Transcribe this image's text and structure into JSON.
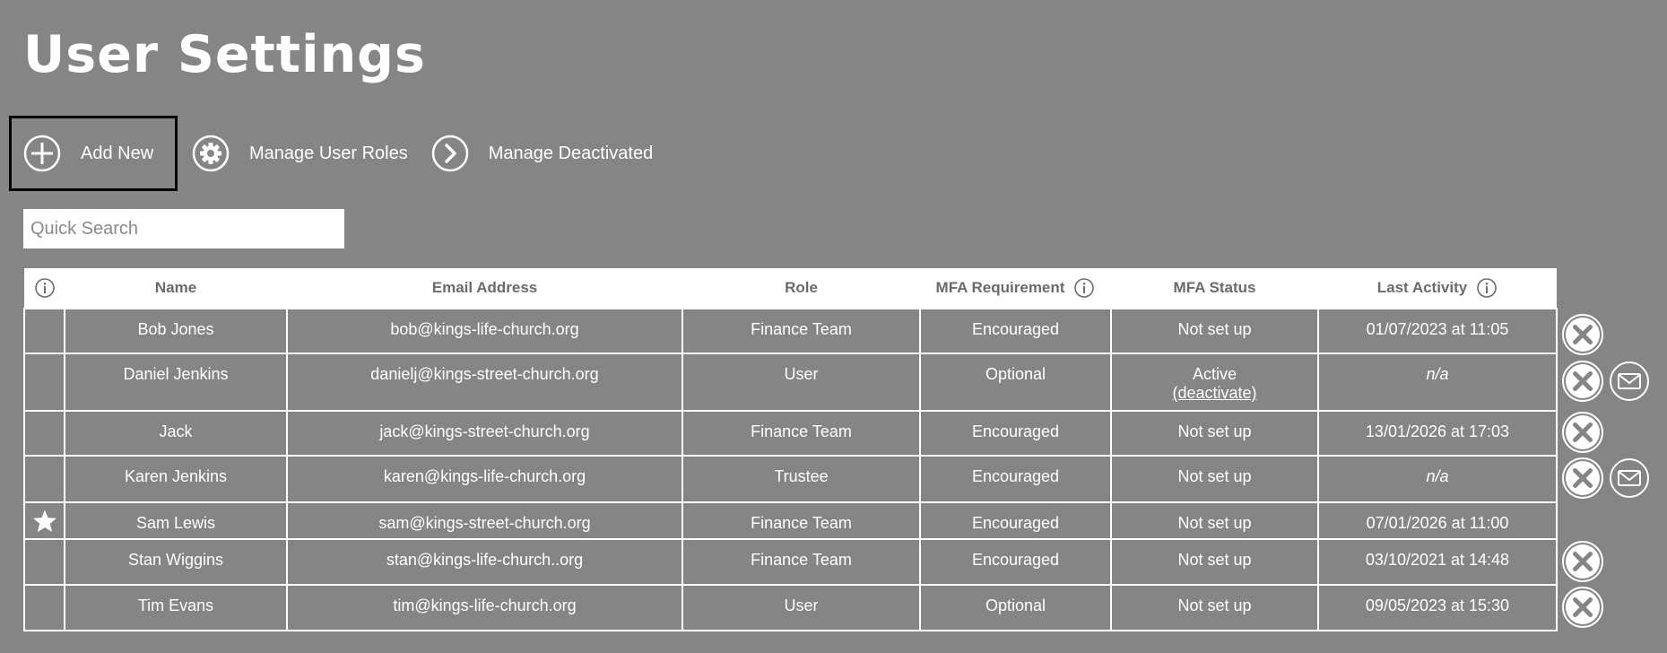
{
  "page": {
    "title": "User Settings"
  },
  "toolbar": {
    "add_new": "Add New",
    "manage_roles": "Manage User Roles",
    "manage_deactivated": "Manage Deactivated"
  },
  "search": {
    "placeholder": "Quick Search",
    "value": ""
  },
  "table": {
    "headers": {
      "name": "Name",
      "email": "Email Address",
      "role": "Role",
      "mfa_requirement": "MFA Requirement",
      "mfa_status": "MFA Status",
      "last_activity": "Last Activity"
    },
    "rows": [
      {
        "flag": "",
        "name": "Bob Jones",
        "email": "bob@kings-life-church.org",
        "role": "Finance Team",
        "mfa_requirement": "Encouraged",
        "mfa_status": "Not set up",
        "mfa_action": "",
        "last_activity": "01/07/2023 at 11:05",
        "actions": [
          "remove"
        ]
      },
      {
        "flag": "",
        "name": "Daniel Jenkins",
        "email": "danielj@kings-street-church.org",
        "role": "User",
        "mfa_requirement": "Optional",
        "mfa_status": "Active",
        "mfa_action": "(deactivate)",
        "last_activity": "n/a",
        "actions": [
          "remove",
          "email"
        ]
      },
      {
        "flag": "",
        "name": "Jack",
        "email": "jack@kings-street-church.org",
        "role": "Finance Team",
        "mfa_requirement": "Encouraged",
        "mfa_status": "Not set up",
        "mfa_action": "",
        "last_activity": "13/01/2026 at 17:03",
        "actions": [
          "remove"
        ]
      },
      {
        "flag": "",
        "name": "Karen Jenkins",
        "email": "karen@kings-life-church.org",
        "role": "Trustee",
        "mfa_requirement": "Encouraged",
        "mfa_status": "Not set up",
        "mfa_action": "",
        "last_activity": "n/a",
        "actions": [
          "remove",
          "email"
        ]
      },
      {
        "flag": "star-icon",
        "name": "Sam Lewis",
        "email": "sam@kings-street-church.org",
        "role": "Finance Team",
        "mfa_requirement": "Encouraged",
        "mfa_status": "Not set up",
        "mfa_action": "",
        "last_activity": "07/01/2026 at 11:00",
        "actions": []
      },
      {
        "flag": "",
        "name": "Stan Wiggins",
        "email": "stan@kings-life-church..org",
        "role": "Finance Team",
        "mfa_requirement": "Encouraged",
        "mfa_status": "Not set up",
        "mfa_action": "",
        "last_activity": "03/10/2021 at 14:48",
        "actions": [
          "remove"
        ]
      },
      {
        "flag": "",
        "name": "Tim Evans",
        "email": "tim@kings-life-church.org",
        "role": "User",
        "mfa_requirement": "Optional",
        "mfa_status": "Not set up",
        "mfa_action": "",
        "last_activity": "09/05/2023 at 15:30",
        "actions": [
          "remove"
        ]
      }
    ]
  },
  "icons": {
    "add": "plus-circle-icon",
    "roles": "gear-icon",
    "deactivated": "chevron-right-circle-icon",
    "info": "info-icon",
    "admin": "star-icon",
    "remove": "close-circle-icon",
    "email": "envelope-icon"
  },
  "colors": {
    "background": "#858585",
    "header_bg": "#ffffff",
    "header_text": "#6b6b6b",
    "text": "#ffffff",
    "focus_border": "#000000"
  }
}
